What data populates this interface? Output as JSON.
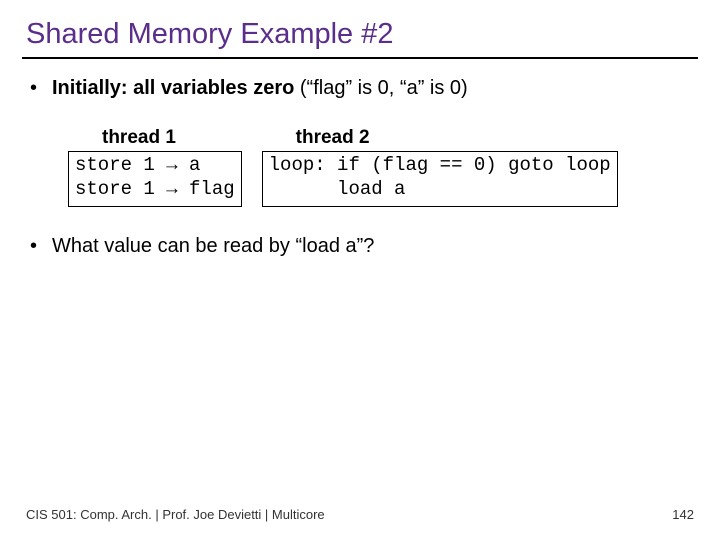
{
  "title": "Shared Memory Example #2",
  "bullet1": {
    "marker": "•",
    "strong": "Initially: all variables zero",
    "rest": " (“flag” is 0, “a” is 0)"
  },
  "code": {
    "col1": {
      "header": "thread 1",
      "line1": "store 1 → a",
      "line2": "store 1 → flag"
    },
    "col2": {
      "header": "thread 2",
      "line1": "loop: if (flag == 0) goto loop",
      "line2": "      load a"
    }
  },
  "question": {
    "marker": "•",
    "text": "What value can be read by “load a”?"
  },
  "footer": {
    "left": "CIS 501: Comp. Arch.  |  Prof. Joe Devietti  |  Multicore",
    "right": "142"
  }
}
